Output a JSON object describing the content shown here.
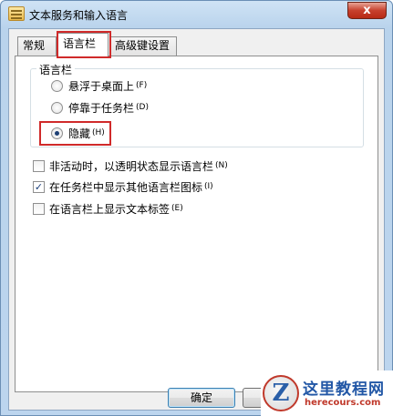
{
  "window": {
    "title": "文本服务和输入语言",
    "close_label": "x"
  },
  "tabs": [
    {
      "label": "常规",
      "active": false
    },
    {
      "label": "语言栏",
      "active": true
    },
    {
      "label": "高级键设置",
      "active": false
    }
  ],
  "language_bar_group": {
    "legend": "语言栏",
    "options": [
      {
        "label": "悬浮于桌面上",
        "shortcut": "(F)",
        "selected": false
      },
      {
        "label": "停靠于任务栏",
        "shortcut": "(D)",
        "selected": false
      },
      {
        "label": "隐藏",
        "shortcut": "(H)",
        "selected": true
      }
    ]
  },
  "checkboxes": [
    {
      "label": "非活动时，以透明状态显示语言栏",
      "shortcut": "(N)",
      "checked": false
    },
    {
      "label": "在任务栏中显示其他语言栏图标",
      "shortcut": "(I)",
      "checked": true
    },
    {
      "label": "在语言栏上显示文本标签",
      "shortcut": "(E)",
      "checked": false
    }
  ],
  "buttons": {
    "ok_label": "确定",
    "cancel_label": ""
  },
  "watermark": {
    "logo_letter": "Z",
    "title": "这里教程网",
    "url": "herecours.com"
  },
  "colors": {
    "highlight_box": "#d02a2a",
    "watermark_title": "#2257a6",
    "watermark_url": "#c0392b"
  },
  "icons": [
    "app-icon",
    "close-icon",
    "radio-icon",
    "checkbox-icon",
    "watermark-logo-icon"
  ]
}
